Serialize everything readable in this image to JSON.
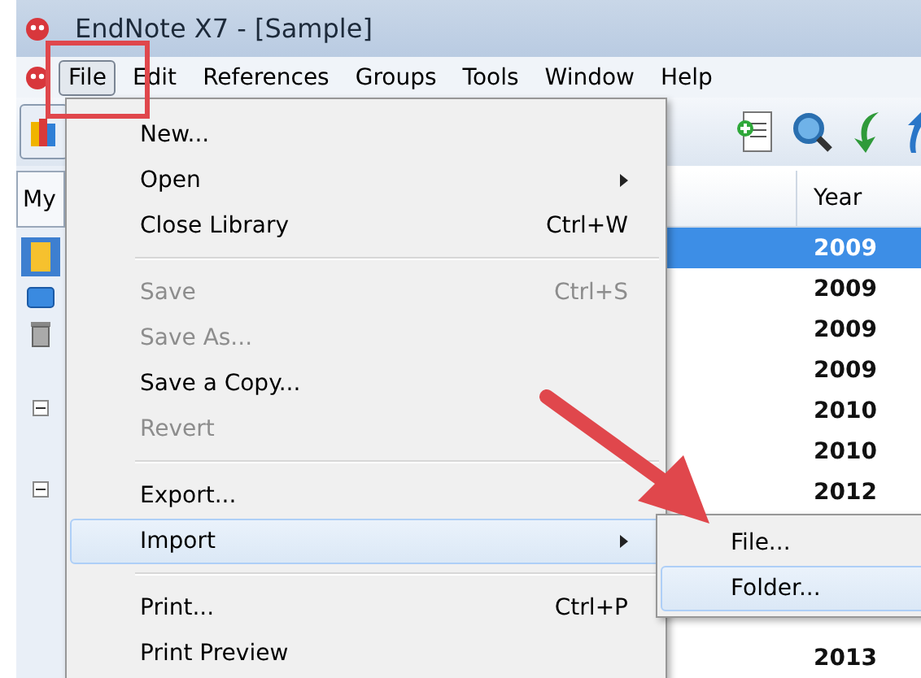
{
  "window": {
    "title": "EndNote X7 - [Sample]"
  },
  "menu_bar": [
    {
      "label": "File",
      "selected": true
    },
    {
      "label": "Edit",
      "selected": false
    },
    {
      "label": "References",
      "selected": false
    },
    {
      "label": "Groups",
      "selected": false
    },
    {
      "label": "Tools",
      "selected": false
    },
    {
      "label": "Window",
      "selected": false
    },
    {
      "label": "Help",
      "selected": false
    }
  ],
  "group_panel": {
    "tab": "My"
  },
  "table": {
    "columns": [
      {
        "label": "Year"
      }
    ],
    "rows": [
      {
        "year": "2009",
        "selected": true
      },
      {
        "year": "2009",
        "selected": false
      },
      {
        "year": "2009",
        "selected": false
      },
      {
        "year": "2009",
        "selected": false
      },
      {
        "year": "2010",
        "selected": false
      },
      {
        "year": "2010",
        "selected": false
      },
      {
        "year": "2012",
        "selected": false
      }
    ],
    "rows_below_menu": [
      {
        "year": "2013",
        "selected": false
      }
    ]
  },
  "file_menu": [
    {
      "kind": "item",
      "label": "New...",
      "disabled": false,
      "selected": false
    },
    {
      "kind": "item",
      "label": "Open",
      "disabled": false,
      "submenu": true,
      "selected": false
    },
    {
      "kind": "item",
      "label": "Close Library",
      "shortcut": "Ctrl+W",
      "disabled": false,
      "selected": false
    },
    {
      "kind": "separator"
    },
    {
      "kind": "item",
      "label": "Save",
      "shortcut": "Ctrl+S",
      "disabled": true,
      "selected": false
    },
    {
      "kind": "item",
      "label": "Save As...",
      "disabled": true,
      "selected": false
    },
    {
      "kind": "item",
      "label": "Save a Copy...",
      "disabled": false,
      "selected": false
    },
    {
      "kind": "item",
      "label": "Revert",
      "disabled": true,
      "selected": false
    },
    {
      "kind": "separator"
    },
    {
      "kind": "item",
      "label": "Export...",
      "disabled": false,
      "selected": false
    },
    {
      "kind": "item",
      "label": "Import",
      "disabled": false,
      "submenu": true,
      "selected": true
    },
    {
      "kind": "separator"
    },
    {
      "kind": "item",
      "label": "Print...",
      "shortcut": "Ctrl+P",
      "disabled": false,
      "selected": false
    },
    {
      "kind": "item",
      "label": "Print Preview",
      "disabled": false,
      "selected": false
    }
  ],
  "import_submenu": [
    {
      "label": "File...",
      "selected": false
    },
    {
      "label": "Folder...",
      "selected": true
    }
  ]
}
